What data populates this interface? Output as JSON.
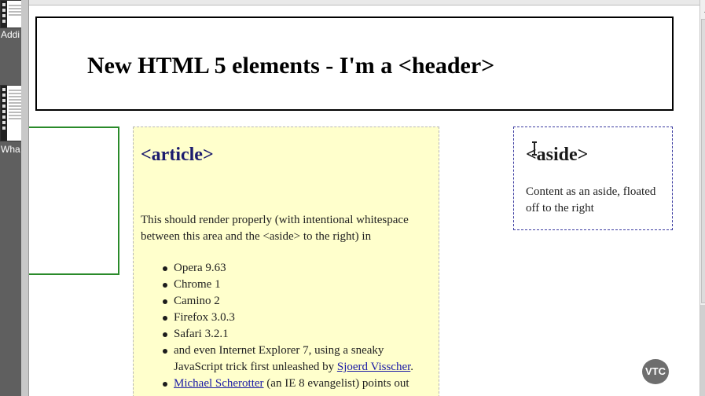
{
  "desktop": {
    "thumbnails": [
      {
        "label": "Addi"
      },
      {
        "label": "Wha"
      }
    ]
  },
  "page": {
    "header": {
      "title": "New HTML 5 elements - I'm a <header>"
    },
    "article": {
      "heading": "<article>",
      "intro": "This should render properly (with intentional whitespace between this area and the <aside> to the right) in",
      "browsers": [
        {
          "text": "Opera 9.63"
        },
        {
          "text": "Chrome 1"
        },
        {
          "text": "Camino 2"
        },
        {
          "text": "Firefox 3.0.3"
        },
        {
          "text": "Safari 3.2.1"
        }
      ],
      "ie_item": {
        "prefix": "and even Internet Explorer 7, using a sneaky JavaScript trick first unleashed by ",
        "link": "Sjoerd Visscher",
        "suffix": "."
      },
      "ie8_item": {
        "link": "Michael Scherotter",
        "suffix": " (an IE 8 evangelist) points out"
      }
    },
    "aside": {
      "heading": "<aside>",
      "text": "Content as an aside, floated off to the right"
    }
  },
  "watermark": {
    "text": "VTC"
  },
  "colors": {
    "article_bg": "#ffffcc",
    "nav_border": "#2a8a2a",
    "link": "#1a1aa6",
    "heading": "#1c1c6e"
  }
}
